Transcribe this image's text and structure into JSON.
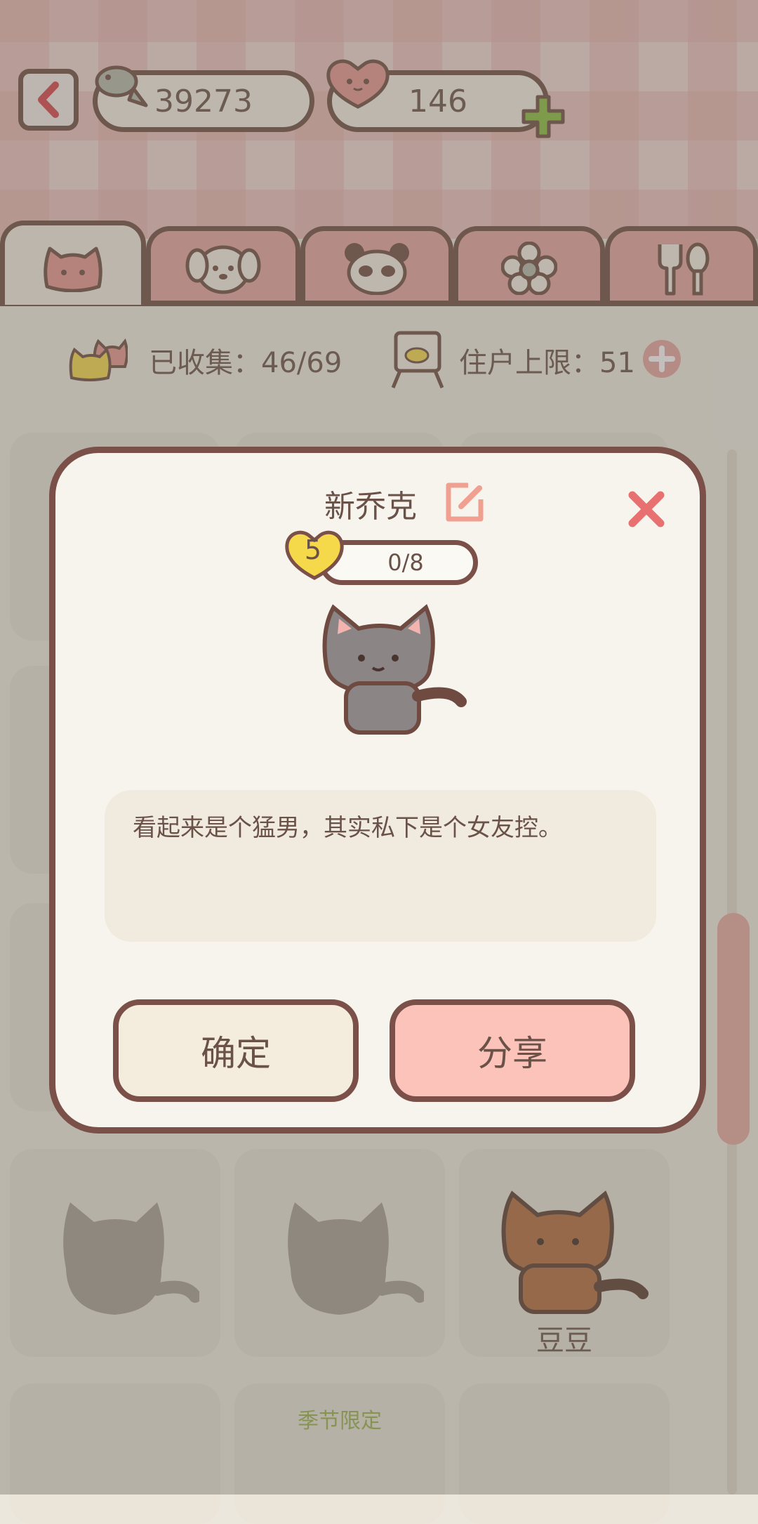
{
  "header": {
    "fish_count": "39273",
    "heart_count": "146",
    "icons": {
      "back": "back-arrow-icon",
      "fish": "fish-icon",
      "heart": "heart-icon",
      "add": "plus-icon"
    }
  },
  "tabs": [
    {
      "name": "cat",
      "icon": "cat-face-icon",
      "active": true
    },
    {
      "name": "dog",
      "icon": "dog-face-icon",
      "active": false
    },
    {
      "name": "panda",
      "icon": "panda-face-icon",
      "active": false
    },
    {
      "name": "flower",
      "icon": "flower-icon",
      "active": false
    },
    {
      "name": "food",
      "icon": "fork-spoon-icon",
      "active": false
    }
  ],
  "stats": {
    "collected_label": "已收集：46/69",
    "residents_label": "住户上限：51"
  },
  "grid": {
    "names": [
      "豆豆"
    ],
    "season_tag": "季节限定"
  },
  "modal": {
    "title": "新乔克",
    "level": "5",
    "progress": "0/8",
    "description": "看起来是个猛男，其实私下是个女友控。",
    "confirm_label": "确定",
    "share_label": "分享"
  },
  "colors": {
    "accent_pink": "#fcc3bb",
    "border_brown": "#7a5048",
    "close_red": "#e87070",
    "level_yellow": "#f6d94a",
    "plus_green": "#8bbf3f"
  }
}
